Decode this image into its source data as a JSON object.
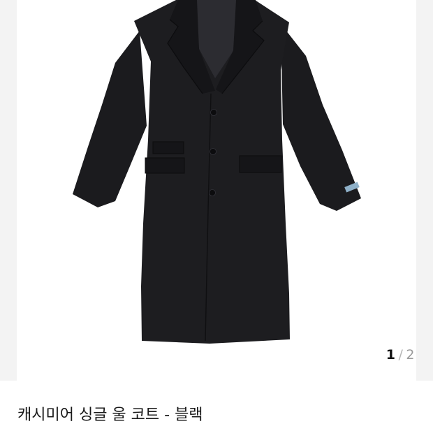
{
  "gallery": {
    "image": {
      "subject": "coat-image",
      "color": "#1b1b1e"
    },
    "counter": {
      "current": "1",
      "separator": "/",
      "total": "2"
    }
  },
  "product": {
    "title": "캐시미어 싱글 울 코트 - 블랙"
  },
  "colors": {
    "background": "#ffffff",
    "gallery_edge": "#f3f3f3",
    "coat": "#1b1b1e",
    "counter_active": "#111111",
    "counter_inactive": "#9a9a9a",
    "title": "#1a1a1a"
  }
}
